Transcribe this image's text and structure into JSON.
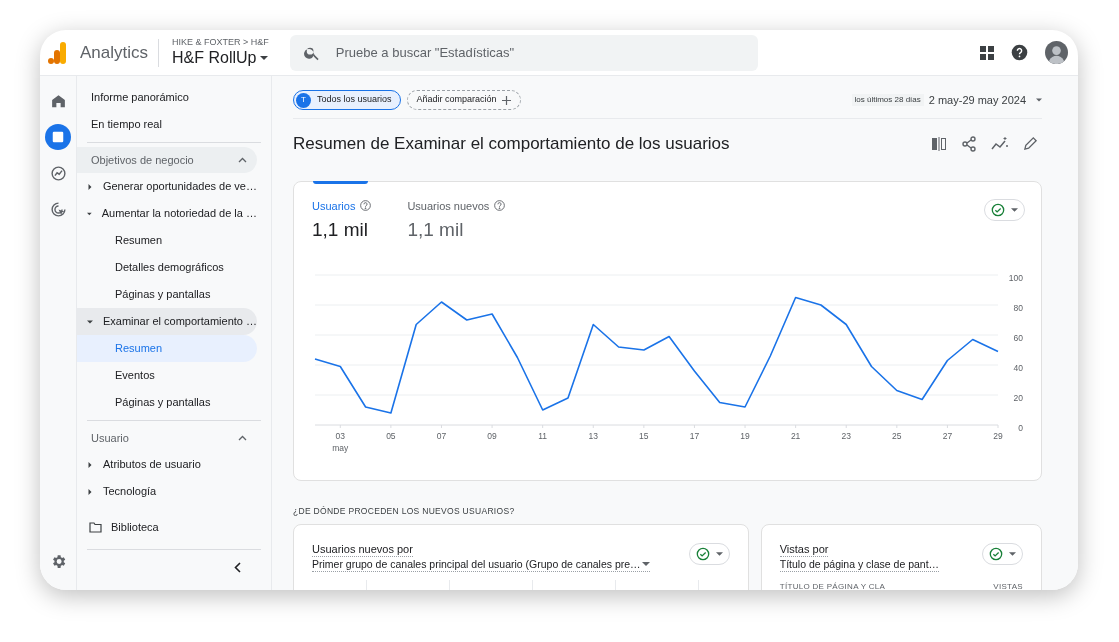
{
  "header": {
    "product": "Analytics",
    "breadcrumb": "HIKE & FOXTER > H&F",
    "property": "H&F RollUp",
    "search": {
      "placeholder": "Pruebe a buscar \"Estadísticas\""
    }
  },
  "rail": [
    {
      "kind": "home",
      "selected": false
    },
    {
      "kind": "reports",
      "selected": true
    },
    {
      "kind": "explore",
      "selected": false
    },
    {
      "kind": "advertising",
      "selected": false
    }
  ],
  "nav": {
    "links": [
      "Informe panorámico",
      "En tiempo real"
    ],
    "sections": [
      {
        "title": "Objetivos de negocio",
        "expanded": true,
        "items": [
          {
            "label": "Generar oportunidades de ve…",
            "expanded": false
          },
          {
            "label": "Aumentar la notoriedad de la …",
            "expanded": true,
            "children": [
              {
                "label": "Resumen",
                "selected": false
              },
              {
                "label": "Detalles demográficos",
                "selected": false
              },
              {
                "label": "Páginas y pantallas",
                "selected": false
              }
            ]
          },
          {
            "label": "Examinar el comportamiento …",
            "expanded": true,
            "children": [
              {
                "label": "Resumen",
                "selected": true
              },
              {
                "label": "Eventos",
                "selected": false
              },
              {
                "label": "Páginas y pantallas",
                "selected": false
              }
            ]
          }
        ]
      },
      {
        "title": "Usuario",
        "expanded": true,
        "items": [
          {
            "label": "Atributos de usuario",
            "expanded": false
          },
          {
            "label": "Tecnología",
            "expanded": false
          }
        ]
      }
    ],
    "library": "Biblioteca"
  },
  "toolbar": {
    "segment": {
      "initial": "T",
      "label": "Todos los usuarios"
    },
    "compare": "Añadir comparación",
    "range_label": "los últimos 28 días",
    "range": "2 may-29 may 2024"
  },
  "title": "Resumen de Examinar el comportamiento de los usuarios",
  "metrics": [
    {
      "label": "Usuarios",
      "value": "1,1 mil",
      "selected": true
    },
    {
      "label": "Usuarios nuevos",
      "value": "1,1 mil",
      "selected": false
    }
  ],
  "chart_data": {
    "type": "line",
    "grid": true,
    "x": [
      2,
      3,
      4,
      5,
      6,
      7,
      8,
      9,
      10,
      11,
      12,
      13,
      14,
      15,
      16,
      17,
      18,
      19,
      20,
      21,
      22,
      23,
      24,
      25,
      26,
      27,
      28,
      29
    ],
    "series": [
      {
        "color": "#1a73e8",
        "values": [
          44,
          39,
          12,
          8,
          67,
          82,
          70,
          74,
          45,
          10,
          18,
          67,
          52,
          50,
          59,
          36,
          15,
          12,
          46,
          85,
          80,
          67,
          39,
          23,
          17,
          43,
          57,
          49
        ]
      }
    ],
    "xlim": [
      2,
      29
    ],
    "ylim": [
      0,
      100
    ],
    "yticks": [
      0,
      20,
      40,
      60,
      80,
      100
    ],
    "xticks": [
      {
        "value": 3,
        "label": "03"
      },
      {
        "value": 5,
        "label": "05"
      },
      {
        "value": 7,
        "label": "07"
      },
      {
        "value": 9,
        "label": "09"
      },
      {
        "value": 11,
        "label": "11"
      },
      {
        "value": 13,
        "label": "13"
      },
      {
        "value": 15,
        "label": "15"
      },
      {
        "value": 17,
        "label": "17"
      },
      {
        "value": 19,
        "label": "19"
      },
      {
        "value": 21,
        "label": "21"
      },
      {
        "value": 23,
        "label": "23"
      },
      {
        "value": 25,
        "label": "25"
      },
      {
        "value": 27,
        "label": "27"
      },
      {
        "value": 29,
        "label": "29"
      }
    ],
    "annotations": [
      "may"
    ]
  },
  "section_heading": "¿DE DÓNDE PROCEDEN LOS NUEVOS USUARIOS?",
  "cards": [
    {
      "title": "Usuarios nuevos por",
      "dimension": "Primer grupo de canales principal del usuario (Grupo de canales pre…",
      "has_caret": true
    },
    {
      "title": "Vistas por",
      "dimension": "Título de página y clase de pant…",
      "has_caret": false,
      "columns": [
        "TÍTULO DE PÁGINA Y CLA",
        "VISTAS"
      ]
    }
  ]
}
